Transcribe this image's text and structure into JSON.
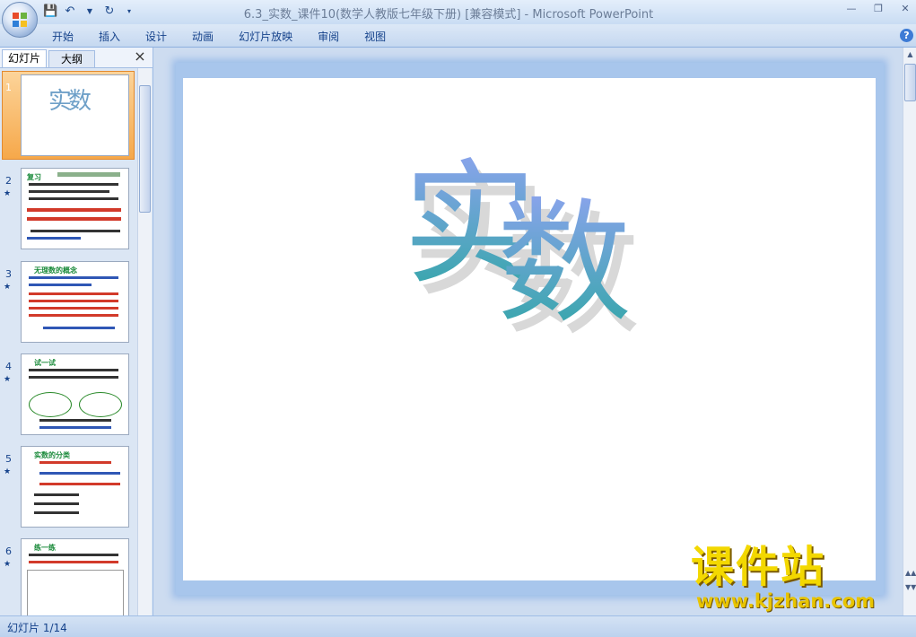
{
  "window": {
    "title": "6.3_实数_课件10(数学人教版七年级下册) [兼容模式] - Microsoft PowerPoint",
    "controls": [
      "minimize-icon",
      "restore-icon",
      "close-icon"
    ]
  },
  "quick_access": [
    "save-icon",
    "undo-icon",
    "dropdown-icon",
    "redo-icon",
    "customize-icon"
  ],
  "ribbon": {
    "tabs": [
      "开始",
      "插入",
      "设计",
      "动画",
      "幻灯片放映",
      "审阅",
      "视图"
    ]
  },
  "left_panel": {
    "tabs": [
      "幻灯片",
      "大纲"
    ],
    "thumbnails": [
      {
        "num": "1",
        "title": "实数"
      },
      {
        "num": "2",
        "title": "复习"
      },
      {
        "num": "3",
        "title": "无理数的概念"
      },
      {
        "num": "4",
        "title": "试一试"
      },
      {
        "num": "5",
        "title": "实数的分类"
      },
      {
        "num": "6",
        "title": "练一练"
      }
    ]
  },
  "slide": {
    "title_chars": [
      "实",
      "数"
    ]
  },
  "status": {
    "slide_info": "幻灯片 1/14"
  },
  "watermark": {
    "title": "课件站",
    "url": "www.kjzhan.com"
  },
  "colors": {
    "title_gradient_top": "#8ea3ef",
    "title_gradient_bottom": "#2fa7a5",
    "selection": "#f6a84a",
    "watermark": "#f3d800"
  }
}
